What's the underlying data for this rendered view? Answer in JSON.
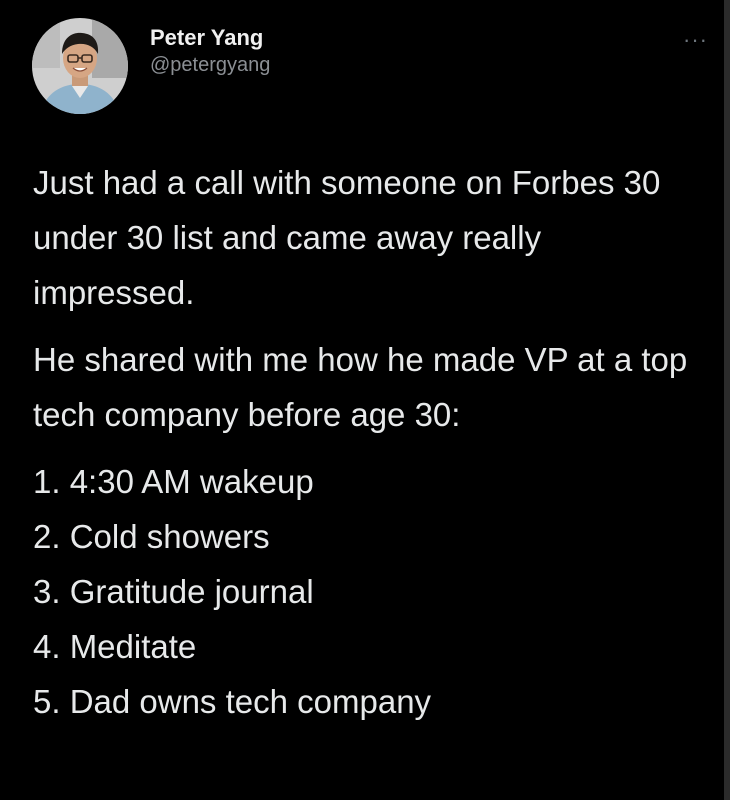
{
  "tweet": {
    "author": {
      "display_name": "Peter Yang",
      "handle": "@petergyang",
      "avatar_icon": "profile-photo"
    },
    "more_label": "···",
    "paragraphs": [
      "Just had a call with someone on Forbes 30 under 30 list and came away really impressed.",
      "He shared with me how he made VP at a top tech company before age 30:"
    ],
    "list_items": [
      "1. 4:30 AM wakeup",
      "2. Cold showers",
      "3. Gratitude journal",
      "4. Meditate",
      "5. Dad owns tech company"
    ]
  },
  "colors": {
    "background": "#000000",
    "text": "#e7e9ea",
    "secondary_text": "#8b8f94"
  }
}
